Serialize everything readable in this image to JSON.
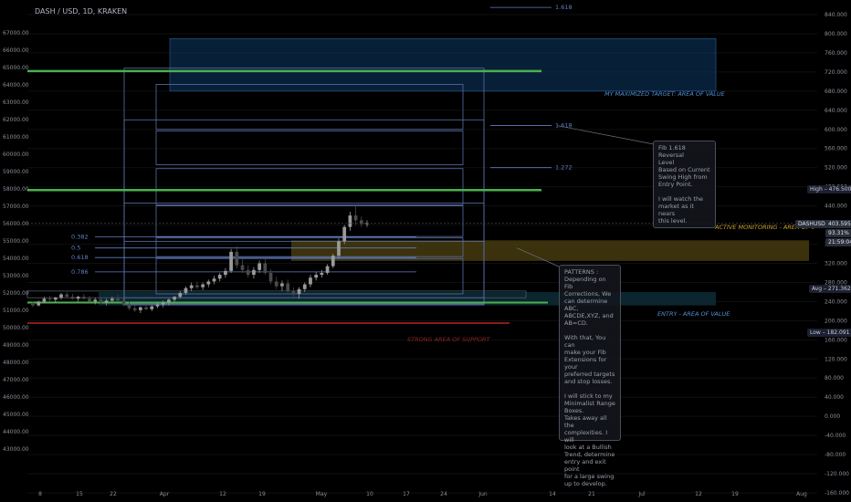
{
  "header": {
    "title": "DASH / USD, 1D, KRAKEN"
  },
  "chart_data": {
    "type": "candlestick",
    "left_axis": {
      "ticks": [
        "67000.00",
        "66000.00",
        "65000.00",
        "64000.00",
        "63000.00",
        "62000.00",
        "61000.00",
        "60000.00",
        "59000.00",
        "58000.00",
        "57000.00",
        "56000.00",
        "55000.00",
        "54000.00",
        "53000.00",
        "52000.00",
        "51000.00",
        "50000.00",
        "49000.00",
        "48000.00",
        "47000.00",
        "46000.00",
        "45000.00",
        "44000.00",
        "43000.00"
      ]
    },
    "right_axis": {
      "ticks": [
        "840.000",
        "800.000",
        "760.000",
        "720.000",
        "680.000",
        "640.000",
        "600.000",
        "560.000",
        "520.000",
        "480.000",
        "440.000",
        "400.000",
        "360.000",
        "320.000",
        "280.000",
        "240.000",
        "200.000",
        "160.000",
        "120.000",
        "80.000",
        "40.000",
        "0.000",
        "-40.000",
        "-80.000",
        "-120.000",
        "-160.000"
      ],
      "ylim": [
        -175,
        860
      ]
    },
    "x_axis": {
      "ticks": [
        "8",
        "15",
        "22",
        "Apr",
        "12",
        "19",
        "May",
        "10",
        "17",
        "24",
        "Jun",
        "14",
        "21",
        "Jul",
        "12",
        "19",
        "Aug"
      ]
    },
    "candles": [
      {
        "o": 235,
        "h": 240,
        "l": 228,
        "c": 232
      },
      {
        "o": 232,
        "h": 242,
        "l": 230,
        "c": 240
      },
      {
        "o": 240,
        "h": 250,
        "l": 236,
        "c": 246
      },
      {
        "o": 246,
        "h": 252,
        "l": 240,
        "c": 244
      },
      {
        "o": 244,
        "h": 250,
        "l": 238,
        "c": 248
      },
      {
        "o": 248,
        "h": 258,
        "l": 244,
        "c": 255
      },
      {
        "o": 255,
        "h": 260,
        "l": 248,
        "c": 250
      },
      {
        "o": 250,
        "h": 256,
        "l": 244,
        "c": 246
      },
      {
        "o": 246,
        "h": 252,
        "l": 240,
        "c": 250
      },
      {
        "o": 250,
        "h": 256,
        "l": 244,
        "c": 246
      },
      {
        "o": 246,
        "h": 252,
        "l": 238,
        "c": 240
      },
      {
        "o": 240,
        "h": 248,
        "l": 234,
        "c": 244
      },
      {
        "o": 244,
        "h": 250,
        "l": 236,
        "c": 238
      },
      {
        "o": 238,
        "h": 246,
        "l": 232,
        "c": 242
      },
      {
        "o": 242,
        "h": 250,
        "l": 238,
        "c": 246
      },
      {
        "o": 246,
        "h": 254,
        "l": 240,
        "c": 242
      },
      {
        "o": 242,
        "h": 248,
        "l": 230,
        "c": 234
      },
      {
        "o": 234,
        "h": 240,
        "l": 222,
        "c": 226
      },
      {
        "o": 226,
        "h": 232,
        "l": 218,
        "c": 222
      },
      {
        "o": 222,
        "h": 230,
        "l": 216,
        "c": 228
      },
      {
        "o": 228,
        "h": 236,
        "l": 222,
        "c": 224
      },
      {
        "o": 224,
        "h": 232,
        "l": 220,
        "c": 230
      },
      {
        "o": 230,
        "h": 238,
        "l": 226,
        "c": 234
      },
      {
        "o": 234,
        "h": 242,
        "l": 228,
        "c": 238
      },
      {
        "o": 238,
        "h": 246,
        "l": 232,
        "c": 244
      },
      {
        "o": 244,
        "h": 252,
        "l": 240,
        "c": 250
      },
      {
        "o": 250,
        "h": 262,
        "l": 246,
        "c": 258
      },
      {
        "o": 258,
        "h": 272,
        "l": 254,
        "c": 268
      },
      {
        "o": 268,
        "h": 280,
        "l": 262,
        "c": 274
      },
      {
        "o": 274,
        "h": 282,
        "l": 266,
        "c": 270
      },
      {
        "o": 270,
        "h": 280,
        "l": 264,
        "c": 276
      },
      {
        "o": 276,
        "h": 286,
        "l": 270,
        "c": 282
      },
      {
        "o": 282,
        "h": 294,
        "l": 276,
        "c": 288
      },
      {
        "o": 288,
        "h": 300,
        "l": 282,
        "c": 296
      },
      {
        "o": 296,
        "h": 310,
        "l": 290,
        "c": 304
      },
      {
        "o": 304,
        "h": 350,
        "l": 300,
        "c": 344
      },
      {
        "o": 344,
        "h": 356,
        "l": 310,
        "c": 316
      },
      {
        "o": 316,
        "h": 328,
        "l": 300,
        "c": 306
      },
      {
        "o": 306,
        "h": 316,
        "l": 290,
        "c": 296
      },
      {
        "o": 296,
        "h": 312,
        "l": 288,
        "c": 306
      },
      {
        "o": 306,
        "h": 326,
        "l": 300,
        "c": 320
      },
      {
        "o": 320,
        "h": 330,
        "l": 296,
        "c": 300
      },
      {
        "o": 300,
        "h": 308,
        "l": 276,
        "c": 282
      },
      {
        "o": 282,
        "h": 292,
        "l": 266,
        "c": 272
      },
      {
        "o": 272,
        "h": 284,
        "l": 262,
        "c": 278
      },
      {
        "o": 278,
        "h": 286,
        "l": 256,
        "c": 262
      },
      {
        "o": 262,
        "h": 270,
        "l": 250,
        "c": 256
      },
      {
        "o": 256,
        "h": 270,
        "l": 246,
        "c": 266
      },
      {
        "o": 266,
        "h": 280,
        "l": 260,
        "c": 276
      },
      {
        "o": 276,
        "h": 296,
        "l": 270,
        "c": 290
      },
      {
        "o": 290,
        "h": 302,
        "l": 284,
        "c": 296
      },
      {
        "o": 296,
        "h": 306,
        "l": 290,
        "c": 300
      },
      {
        "o": 300,
        "h": 318,
        "l": 296,
        "c": 314
      },
      {
        "o": 314,
        "h": 340,
        "l": 310,
        "c": 336
      },
      {
        "o": 336,
        "h": 372,
        "l": 330,
        "c": 366
      },
      {
        "o": 366,
        "h": 400,
        "l": 360,
        "c": 396
      },
      {
        "o": 396,
        "h": 428,
        "l": 388,
        "c": 420
      },
      {
        "o": 420,
        "h": 440,
        "l": 400,
        "c": 410
      },
      {
        "o": 410,
        "h": 418,
        "l": 396,
        "c": 402
      },
      {
        "o": 402,
        "h": 410,
        "l": 396,
        "c": 404
      }
    ]
  },
  "fib_levels": [
    {
      "label": "0.382",
      "value": 375
    },
    {
      "label": "0.5",
      "value": 352
    },
    {
      "label": "0.618",
      "value": 332
    },
    {
      "label": "0.786",
      "value": 302
    },
    {
      "label": "1.272",
      "value": 520
    },
    {
      "label": "1.618",
      "value": 608
    },
    {
      "label": "1.618",
      "value": 855
    }
  ],
  "annotations": {
    "max_target": "MY MAXIMIZED TARGET: AREA OF VALUE",
    "active_monitoring": "ACTIVE MONITORING - AREA OF V",
    "entry": "ENTRY - AREA OF VALUE",
    "support": "STRONG AREA OF SUPPORT",
    "note1": "Fib 1.618 Reversal\nLevel\nBased on Current\nSwing High from\nEntry Point.\n\nI will watch the\nmarket as it nears\nthis level.",
    "note2": "PATTERNS :\nDepending on Fib\nCorrections, We\ncan determine ABC,\nABCDE,XYZ, and\nAB=CD.\n\nWith that, You can\nmake your Fib\nExtensions for your\npreferred targets\nand stop losses.\n\nI will stick to my\nMinimalist Range\nBoxes.\nTakes away all the\ncomplexities. I will\nlook at a Bullish\nTrend, determine\nentry and exit point\nfor a large swing\nup to develop."
  },
  "price_tags": {
    "high": "High – 476.500",
    "symbol": "DASHUSD",
    "last": "403.595",
    "pct": "93.31%",
    "countdown": "21:59:04",
    "avg": "Avg – 271.362",
    "low": "Low – 182.091"
  },
  "colors": {
    "background": "#000000",
    "up": "#9a9a9a",
    "down": "#4a4a4a",
    "green": "#4caf50",
    "red": "#8b1a1a",
    "blue_zone": "#0d3a66",
    "yellow_zone": "#4a3f10",
    "fib": "#5e7fc2",
    "box": "#5a6fa8"
  }
}
